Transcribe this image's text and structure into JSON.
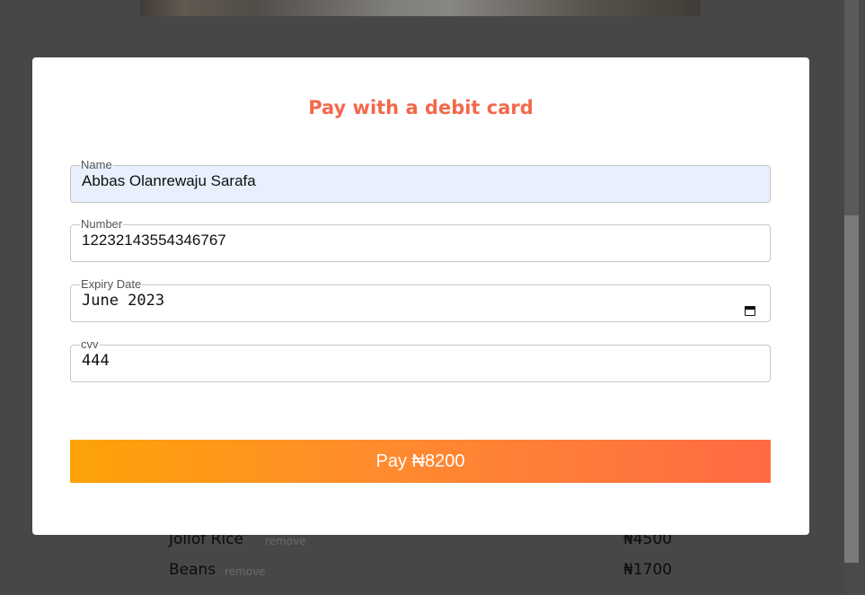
{
  "modal": {
    "title": "Pay with a debit card",
    "fields": {
      "name": {
        "label": "Name",
        "value": "Abbas Olanrewaju Sarafa"
      },
      "number": {
        "label": "Number",
        "value": "12232143554346767"
      },
      "expiry": {
        "label": "Expiry Date",
        "value": "June 2023"
      },
      "cvv": {
        "label": "cvv",
        "value": "444"
      }
    },
    "pay_button_label": "Pay ₦8200"
  },
  "cart": {
    "items": [
      {
        "name": "Jollof Rice",
        "remove_label": "remove",
        "price": "₦4500"
      },
      {
        "name": "Beans",
        "remove_label": "remove",
        "price": "₦1700"
      }
    ]
  },
  "colors": {
    "accent": "#f2694c",
    "button_start": "#fda307",
    "button_end": "#ff6a44",
    "overlay": "#474747",
    "autofill_bg": "#e8f0fe"
  },
  "icons": {
    "expiry_picker": "calendar-icon"
  }
}
